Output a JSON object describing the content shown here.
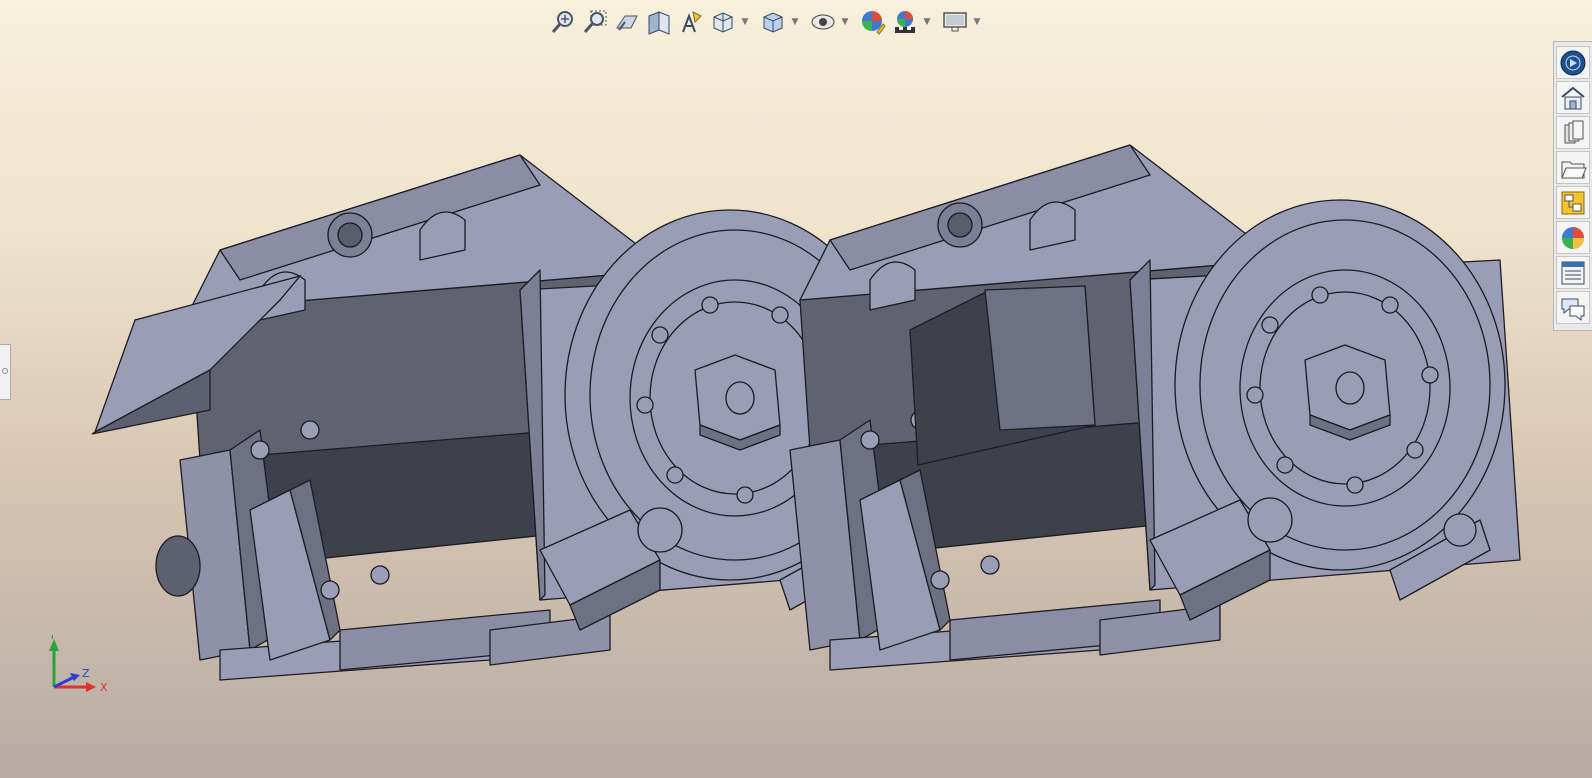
{
  "toolbar": {
    "items": [
      {
        "name": "zoom-to-fit-icon"
      },
      {
        "name": "zoom-to-area-icon"
      },
      {
        "name": "previous-view-icon"
      },
      {
        "name": "section-view-icon"
      },
      {
        "name": "dynamic-annotation-icon"
      },
      {
        "name": "view-orientation-icon",
        "dropdown": true
      },
      {
        "name": "display-style-icon",
        "dropdown": true
      },
      {
        "name": "hide-show-items-icon",
        "dropdown": true
      },
      {
        "name": "edit-appearance-icon"
      },
      {
        "name": "apply-scene-icon",
        "dropdown": true
      },
      {
        "name": "view-settings-icon",
        "dropdown": true
      }
    ]
  },
  "task_pane": {
    "tabs": [
      {
        "name": "solidworks-resources-icon"
      },
      {
        "name": "design-library-icon"
      },
      {
        "name": "file-explorer-icon"
      },
      {
        "name": "view-palette-icon"
      },
      {
        "name": "appearances-scenes-icon"
      },
      {
        "name": "custom-properties-icon"
      },
      {
        "name": "forum-icon"
      },
      {
        "name": "3d-content-central-icon"
      }
    ]
  },
  "triad": {
    "x_label": "X",
    "y_label": "Y",
    "z_label": "Z",
    "colors": {
      "x": "#e0302f",
      "y": "#2aa33a",
      "z": "#2b3fd0"
    }
  },
  "model_colors": {
    "face_light": "#9a9db6",
    "face_mid": "#7c7f95",
    "face_dark": "#3e4149",
    "edge": "#1c1c22"
  }
}
